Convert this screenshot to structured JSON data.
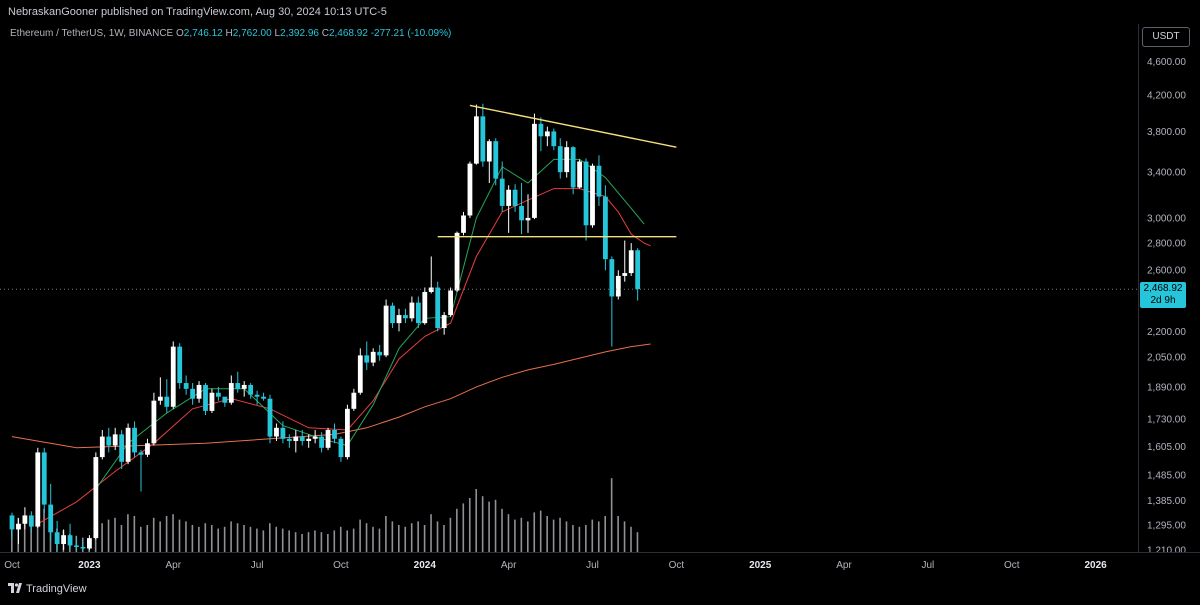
{
  "header": {
    "publish_line": "NebraskanGooner published on TradingView.com, Aug 30, 2024 10:13 UTC-5"
  },
  "legend": {
    "symbol": "Ethereum / TetherUS, 1W, BINANCE",
    "open_label": "O",
    "open": "2,746.12",
    "high_label": "H",
    "high": "2,762.00",
    "low_label": "L",
    "low": "2,392.96",
    "close_label": "C",
    "close": "2,468.92",
    "change": "-277.21 (-10.09%)"
  },
  "currency_button": "USDT",
  "last_price": {
    "value": "2,468.92",
    "countdown": "2d 9h"
  },
  "footer": {
    "brand": "TradingView"
  },
  "colors": {
    "up": "#ffffff",
    "down": "#26c6da",
    "ema_long": "#e8704a",
    "ema_mid": "#e83e3e",
    "ema_short": "#26a65b",
    "trendline": "#f5e17a",
    "volume": "#bfc2c9"
  },
  "chart_data": {
    "type": "candlestick",
    "title": "Ethereum / TetherUS, 1W, BINANCE",
    "y_scale": "log",
    "ylim": [
      1210,
      4800
    ],
    "y_ticks": [
      "4,600.00",
      "4,200.00",
      "3,800.00",
      "3,400.00",
      "3,000.00",
      "2,800.00",
      "2,600.00",
      "2,200.00",
      "2,050.00",
      "1,890.00",
      "1,730.00",
      "1,605.00",
      "1,485.00",
      "1,385.00",
      "1,295.00",
      "1,210.00"
    ],
    "y_tick_values": [
      4600,
      4200,
      3800,
      3400,
      3000,
      2800,
      2600,
      2200,
      2050,
      1890,
      1730,
      1605,
      1485,
      1385,
      1295,
      1210
    ],
    "x_ticks": [
      "Oct",
      "2023",
      "Apr",
      "Jul",
      "Oct",
      "2024",
      "Apr",
      "Jul",
      "Oct",
      "2025",
      "Apr",
      "Jul",
      "Oct",
      "2026"
    ],
    "x_tick_weeks": [
      0,
      12,
      25,
      38,
      51,
      64,
      77,
      90,
      103,
      116,
      129,
      142,
      155,
      168
    ],
    "candles": [
      [
        1330,
        1340,
        1250,
        1280
      ],
      [
        1280,
        1320,
        1230,
        1300
      ],
      [
        1300,
        1360,
        1280,
        1330
      ],
      [
        1330,
        1345,
        1270,
        1290
      ],
      [
        1290,
        1600,
        1285,
        1580
      ],
      [
        1580,
        1600,
        1340,
        1370
      ],
      [
        1370,
        1450,
        1240,
        1270
      ],
      [
        1270,
        1310,
        1210,
        1230
      ],
      [
        1230,
        1280,
        1210,
        1260
      ],
      [
        1260,
        1300,
        1215,
        1225
      ],
      [
        1225,
        1250,
        1210,
        1220
      ],
      [
        1220,
        1240,
        1210,
        1215
      ],
      [
        1215,
        1260,
        1210,
        1250
      ],
      [
        1250,
        1580,
        1245,
        1560
      ],
      [
        1560,
        1680,
        1550,
        1650
      ],
      [
        1650,
        1690,
        1580,
        1610
      ],
      [
        1610,
        1690,
        1590,
        1660
      ],
      [
        1660,
        1680,
        1510,
        1540
      ],
      [
        1540,
        1710,
        1530,
        1690
      ],
      [
        1690,
        1720,
        1560,
        1580
      ],
      [
        1580,
        1590,
        1420,
        1570
      ],
      [
        1570,
        1640,
        1560,
        1620
      ],
      [
        1620,
        1860,
        1610,
        1820
      ],
      [
        1820,
        1940,
        1800,
        1840
      ],
      [
        1840,
        1930,
        1760,
        1790
      ],
      [
        1790,
        2140,
        1780,
        2110
      ],
      [
        2110,
        2130,
        1880,
        1910
      ],
      [
        1910,
        1950,
        1850,
        1880
      ],
      [
        1880,
        1910,
        1800,
        1830
      ],
      [
        1830,
        1920,
        1810,
        1900
      ],
      [
        1900,
        1910,
        1750,
        1770
      ],
      [
        1770,
        1880,
        1760,
        1860
      ],
      [
        1860,
        1890,
        1820,
        1840
      ],
      [
        1840,
        1830,
        1790,
        1810
      ],
      [
        1810,
        1950,
        1800,
        1910
      ],
      [
        1910,
        1970,
        1860,
        1880
      ],
      [
        1880,
        1920,
        1840,
        1900
      ],
      [
        1900,
        1910,
        1830,
        1850
      ],
      [
        1850,
        1870,
        1800,
        1840
      ],
      [
        1840,
        1860,
        1820,
        1830
      ],
      [
        1830,
        1850,
        1620,
        1650
      ],
      [
        1650,
        1710,
        1630,
        1690
      ],
      [
        1690,
        1720,
        1620,
        1640
      ],
      [
        1640,
        1660,
        1600,
        1630
      ],
      [
        1630,
        1680,
        1580,
        1650
      ],
      [
        1650,
        1680,
        1610,
        1630
      ],
      [
        1630,
        1660,
        1600,
        1640
      ],
      [
        1640,
        1680,
        1620,
        1650
      ],
      [
        1650,
        1670,
        1580,
        1600
      ],
      [
        1600,
        1690,
        1590,
        1680
      ],
      [
        1680,
        1710,
        1620,
        1640
      ],
      [
        1640,
        1650,
        1540,
        1560
      ],
      [
        1560,
        1800,
        1550,
        1780
      ],
      [
        1780,
        1880,
        1770,
        1860
      ],
      [
        1860,
        2100,
        1850,
        2060
      ],
      [
        2060,
        2140,
        1980,
        2020
      ],
      [
        2020,
        2100,
        2000,
        2080
      ],
      [
        2080,
        2120,
        2030,
        2060
      ],
      [
        2060,
        2400,
        2050,
        2360
      ],
      [
        2360,
        2380,
        2220,
        2250
      ],
      [
        2250,
        2340,
        2200,
        2300
      ],
      [
        2300,
        2340,
        2250,
        2280
      ],
      [
        2280,
        2420,
        2260,
        2380
      ],
      [
        2380,
        2420,
        2220,
        2250
      ],
      [
        2250,
        2480,
        2240,
        2450
      ],
      [
        2450,
        2700,
        2440,
        2480
      ],
      [
        2480,
        2520,
        2200,
        2220
      ],
      [
        2220,
        2320,
        2180,
        2300
      ],
      [
        2300,
        2480,
        2290,
        2460
      ],
      [
        2460,
        2890,
        2450,
        2880
      ],
      [
        2880,
        3050,
        2860,
        3020
      ],
      [
        3020,
        3500,
        3000,
        3480
      ],
      [
        3480,
        4090,
        3470,
        3960
      ],
      [
        3960,
        4100,
        3450,
        3500
      ],
      [
        3500,
        3720,
        3300,
        3700
      ],
      [
        3700,
        3730,
        3280,
        3340
      ],
      [
        3340,
        3500,
        3050,
        3100
      ],
      [
        3100,
        3280,
        2880,
        3240
      ],
      [
        3240,
        3290,
        3050,
        3100
      ],
      [
        3100,
        3300,
        2870,
        2980
      ],
      [
        2980,
        3200,
        2880,
        3000
      ],
      [
        3000,
        3990,
        2990,
        3880
      ],
      [
        3880,
        3950,
        3600,
        3750
      ],
      [
        3750,
        3850,
        3650,
        3800
      ],
      [
        3800,
        3830,
        3610,
        3650
      ],
      [
        3650,
        3730,
        3340,
        3400
      ],
      [
        3400,
        3700,
        3350,
        3640
      ],
      [
        3640,
        3650,
        3200,
        3260
      ],
      [
        3260,
        3520,
        3250,
        3500
      ],
      [
        3500,
        3530,
        2820,
        2940
      ],
      [
        2940,
        3480,
        2920,
        3460
      ],
      [
        3460,
        3560,
        3100,
        3180
      ],
      [
        3180,
        3280,
        2600,
        2680
      ],
      [
        2680,
        2700,
        2110,
        2420
      ],
      [
        2420,
        2600,
        2400,
        2560
      ],
      [
        2560,
        2820,
        2520,
        2580
      ],
      [
        2580,
        2800,
        2560,
        2746
      ],
      [
        2746,
        2762,
        2393,
        2469
      ]
    ],
    "volume": [
      30,
      38,
      34,
      30,
      44,
      48,
      32,
      26,
      24,
      20,
      18,
      16,
      14,
      28,
      32,
      36,
      38,
      30,
      42,
      40,
      28,
      30,
      38,
      34,
      40,
      42,
      36,
      34,
      30,
      28,
      32,
      30,
      26,
      28,
      34,
      32,
      30,
      28,
      26,
      24,
      32,
      28,
      26,
      24,
      22,
      20,
      22,
      24,
      22,
      20,
      24,
      28,
      24,
      26,
      36,
      32,
      28,
      26,
      40,
      34,
      30,
      28,
      32,
      34,
      30,
      42,
      34,
      30,
      38,
      48,
      54,
      60,
      70,
      62,
      56,
      58,
      48,
      42,
      36,
      38,
      34,
      44,
      46,
      40,
      36,
      38,
      34,
      30,
      28,
      30,
      36,
      34,
      40,
      82,
      40,
      34,
      28,
      22
    ],
    "ema_long": [
      [
        0,
        1650
      ],
      [
        10,
        1600
      ],
      [
        20,
        1610
      ],
      [
        30,
        1620
      ],
      [
        40,
        1640
      ],
      [
        50,
        1660
      ],
      [
        55,
        1690
      ],
      [
        60,
        1740
      ],
      [
        64,
        1790
      ],
      [
        68,
        1830
      ],
      [
        72,
        1890
      ],
      [
        76,
        1940
      ],
      [
        80,
        1980
      ],
      [
        84,
        2010
      ],
      [
        88,
        2045
      ],
      [
        92,
        2080
      ],
      [
        96,
        2110
      ],
      [
        99,
        2125
      ]
    ],
    "ema_mid": [
      [
        4,
        1300
      ],
      [
        10,
        1380
      ],
      [
        16,
        1500
      ],
      [
        22,
        1620
      ],
      [
        28,
        1780
      ],
      [
        34,
        1830
      ],
      [
        40,
        1780
      ],
      [
        46,
        1690
      ],
      [
        52,
        1680
      ],
      [
        56,
        1820
      ],
      [
        60,
        2040
      ],
      [
        64,
        2170
      ],
      [
        68,
        2250
      ],
      [
        72,
        2700
      ],
      [
        76,
        3050
      ],
      [
        80,
        3150
      ],
      [
        84,
        3250
      ],
      [
        88,
        3250
      ],
      [
        92,
        3180
      ],
      [
        94,
        3050
      ],
      [
        96,
        2870
      ],
      [
        98,
        2800
      ],
      [
        99,
        2780
      ]
    ],
    "ema_short": [
      [
        13,
        1430
      ],
      [
        18,
        1620
      ],
      [
        24,
        1760
      ],
      [
        30,
        1880
      ],
      [
        36,
        1880
      ],
      [
        42,
        1700
      ],
      [
        48,
        1640
      ],
      [
        52,
        1610
      ],
      [
        56,
        1800
      ],
      [
        60,
        2100
      ],
      [
        64,
        2280
      ],
      [
        68,
        2290
      ],
      [
        72,
        3000
      ],
      [
        76,
        3450
      ],
      [
        80,
        3300
      ],
      [
        84,
        3520
      ],
      [
        88,
        3520
      ],
      [
        92,
        3350
      ],
      [
        96,
        3080
      ],
      [
        98,
        2950
      ]
    ],
    "trendlines": [
      {
        "type": "resistance",
        "from": [
          71,
          4080
        ],
        "to": [
          103,
          3640
        ]
      },
      {
        "type": "support",
        "from": [
          66,
          2850
        ],
        "to": [
          103,
          2850
        ]
      }
    ],
    "last_close": 2468.92
  }
}
